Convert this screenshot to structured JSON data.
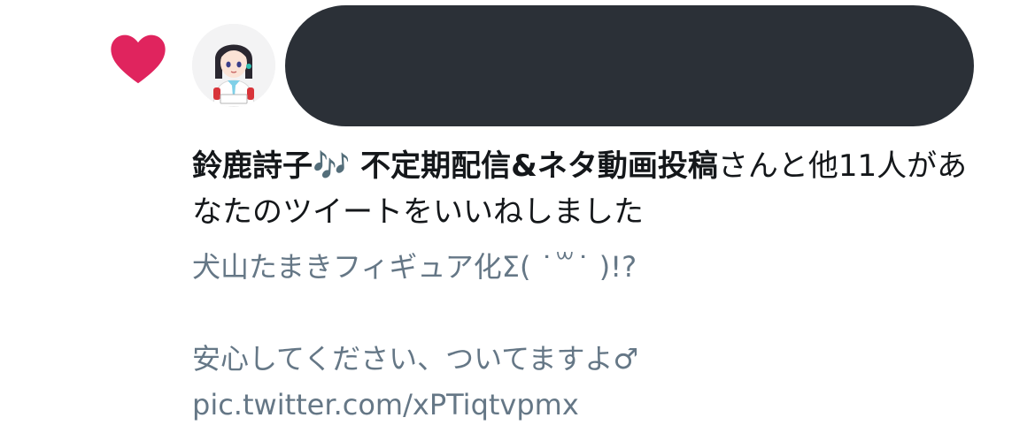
{
  "icons": {
    "like": "heart-icon",
    "like_color": "#e0245e"
  },
  "notification": {
    "user_name": "鈴鹿詩子🎶 不定期配信&ネタ動画投稿",
    "suffix": "さんと他11人があなたのツイートをいいねしました"
  },
  "tweet": {
    "line1": "犬山たまきフィギュア化Σ( ˙꒳˙ )!?",
    "line2": "安心してください、ついてますよ♂",
    "link": "pic.twitter.com/xPTiqtvpmx"
  },
  "colors": {
    "primary_text": "#14171a",
    "secondary_text": "#657786",
    "redaction": "#2b3037"
  }
}
